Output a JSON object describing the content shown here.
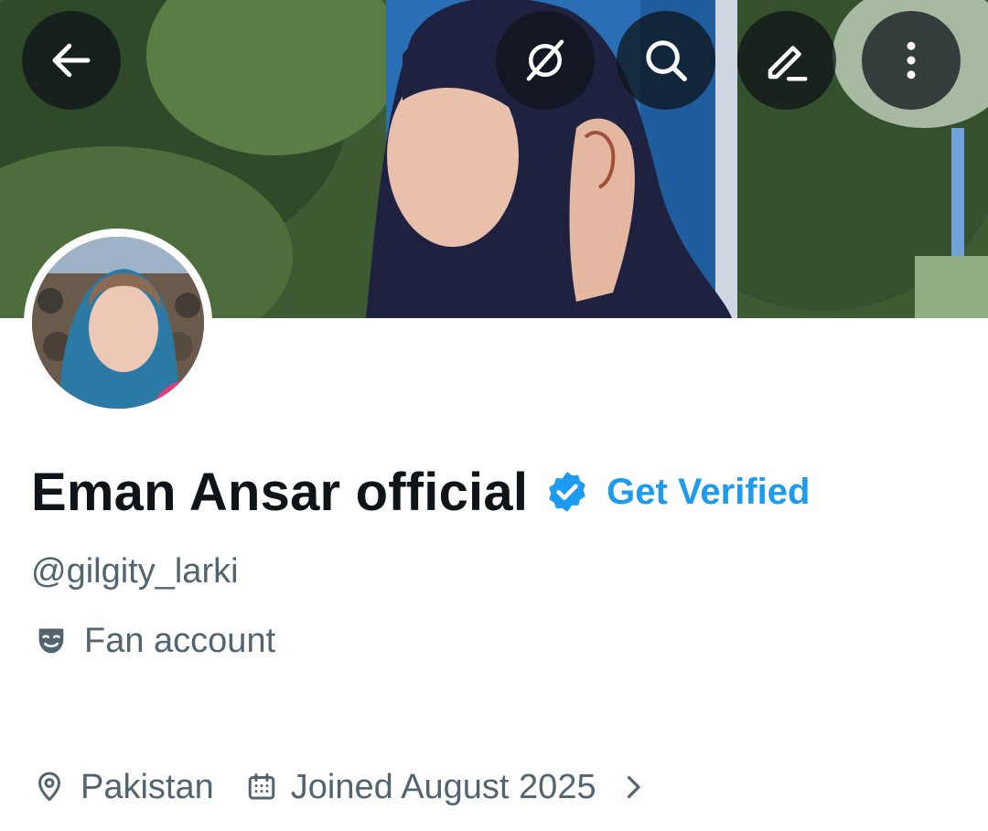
{
  "header": {
    "back_icon": "arrow-left-icon",
    "grok_icon": "grok-icon",
    "search_icon": "search-icon",
    "edit_icon": "edit-icon",
    "more_icon": "more-vertical-icon"
  },
  "profile": {
    "display_name": "Eman Ansar official",
    "verified_badge_color": "#1d9bf0",
    "get_verified_label": "Get Verified",
    "handle": "@gilgity_larki",
    "category": "Fan account",
    "location": "Pakistan",
    "joined": "Joined August 2025"
  },
  "colors": {
    "text_primary": "#0f1419",
    "text_secondary": "#536471",
    "accent": "#1d9bf0"
  }
}
